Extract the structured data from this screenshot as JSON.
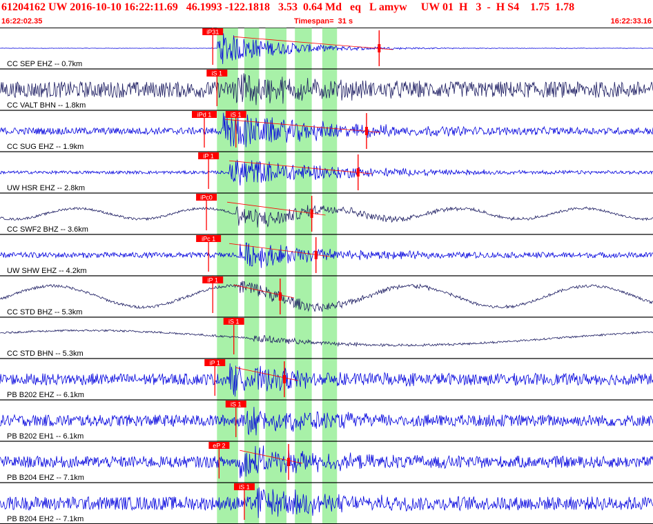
{
  "header": {
    "line1": "61204162 UW 2016-10-10 16:22:11.69   46.1993 -122.1818   3.53  0.64 Md   eq   L amyw     UW 01  H   3  -  H S4    1.75  1.78",
    "start_time": "16:22:02.35",
    "timespan": "Timespan=  31 s",
    "end_time": "16:22:33.16"
  },
  "colors": {
    "header_text": "#ff0000",
    "pick": "#ff0000",
    "highlight": "#99ee99",
    "trace_blue": "#0000dd",
    "trace_navy": "#1a1a60",
    "divider": "#000000"
  },
  "chart_data": {
    "type": "line",
    "x_unit": "s",
    "x_range": [
      0,
      31
    ],
    "green_bands_s": [
      [
        10.3,
        11.3
      ],
      [
        11.6,
        12.3
      ],
      [
        12.6,
        13.6
      ],
      [
        14.0,
        14.8
      ],
      [
        15.3,
        16.0
      ]
    ],
    "traces": [
      {
        "label": "CC SEP EHZ -- 0.7km",
        "color": "#0000dd",
        "pick": "iP31",
        "pick_t": 10.1,
        "onset": 10.3,
        "noise": 0.01,
        "amp": 0.9,
        "decay": 3.0,
        "wave_amp": 0,
        "wave_period": 0,
        "marker_t": 18.0
      },
      {
        "label": "CC VALT BHN -- 1.8km",
        "color": "#1a1a60",
        "pick": "iS 1",
        "pick_t": 10.3,
        "onset": 11.0,
        "noise": 0.42,
        "amp": 0.85,
        "decay": 3.5,
        "wave_amp": 0,
        "wave_period": 0
      },
      {
        "label": "CC SUG EHZ -- 1.9km",
        "color": "#0000dd",
        "pick": "iPd 1",
        "pick_t": 9.7,
        "onset": 10.6,
        "noise": 0.18,
        "amp": 0.95,
        "decay": 5.0,
        "wave_amp": 0,
        "wave_period": 0,
        "pick2": "iS 1",
        "pick2_t": 11.2,
        "marker_t": 17.4
      },
      {
        "label": "UW HSR EHZ -- 2.8km",
        "color": "#0000dd",
        "pick": "iP 1",
        "pick_t": 9.9,
        "onset": 10.9,
        "noise": 0.08,
        "amp": 0.8,
        "decay": 5.0,
        "wave_amp": 0,
        "wave_period": 0,
        "marker_t": 17.0
      },
      {
        "label": "CC SWF2 BHZ -- 3.6km",
        "color": "#1a1a60",
        "pick": "iPc0",
        "pick_t": 9.8,
        "onset": 11.2,
        "noise": 0.06,
        "amp": 0.55,
        "decay": 5.0,
        "wave_amp": 0.28,
        "wave_period": 6.0,
        "marker_t": 14.8
      },
      {
        "label": "UW SHW EHZ -- 4.2km",
        "color": "#0000dd",
        "pick": "iPc 1",
        "pick_t": 9.9,
        "onset": 11.4,
        "noise": 0.14,
        "amp": 0.7,
        "decay": 4.0,
        "wave_amp": 0,
        "wave_period": 0,
        "marker_t": 15.0
      },
      {
        "label": "CC STD BHZ -- 5.3km",
        "color": "#1a1a60",
        "pick": "iP 1",
        "pick_t": 10.1,
        "onset": 11.4,
        "noise": 0.07,
        "amp": 0.45,
        "decay": 4.5,
        "wave_amp": 0.55,
        "wave_period": 8.5,
        "marker_t": 13.3
      },
      {
        "label": "CC STD BHN -- 5.3km",
        "color": "#1a1a60",
        "pick": "iS 1",
        "pick_t": 11.1,
        "onset": 12.0,
        "noise": 0.05,
        "amp": 0.2,
        "decay": 4.0,
        "wave_amp": 0.38,
        "wave_period": 30.0
      },
      {
        "label": "PB B202 EHZ -- 6.1km",
        "color": "#0000dd",
        "pick": "iP 1",
        "pick_t": 10.2,
        "onset": 10.9,
        "noise": 0.3,
        "amp": 0.7,
        "decay": 4.0,
        "wave_amp": 0,
        "wave_period": 0,
        "marker_t": 13.5
      },
      {
        "label": "PB B202 EH1 -- 6.1km",
        "color": "#0000dd",
        "pick": "iS 1",
        "pick_t": 11.2,
        "onset": 11.7,
        "noise": 0.3,
        "amp": 0.7,
        "decay": 3.5,
        "wave_amp": 0,
        "wave_period": 0
      },
      {
        "label": "PB B204 EHZ -- 7.1km",
        "color": "#0000dd",
        "pick": "eP 2",
        "pick_t": 10.4,
        "onset": 11.3,
        "noise": 0.3,
        "amp": 0.75,
        "decay": 4.0,
        "wave_amp": 0,
        "wave_period": 0,
        "marker_t": 13.7
      },
      {
        "label": "PB B204 EH2 -- 7.1km",
        "color": "#0000dd",
        "pick": "iS 1",
        "pick_t": 11.6,
        "onset": 12.2,
        "noise": 0.35,
        "amp": 0.75,
        "decay": 3.0,
        "wave_amp": 0,
        "wave_period": 0
      }
    ]
  }
}
